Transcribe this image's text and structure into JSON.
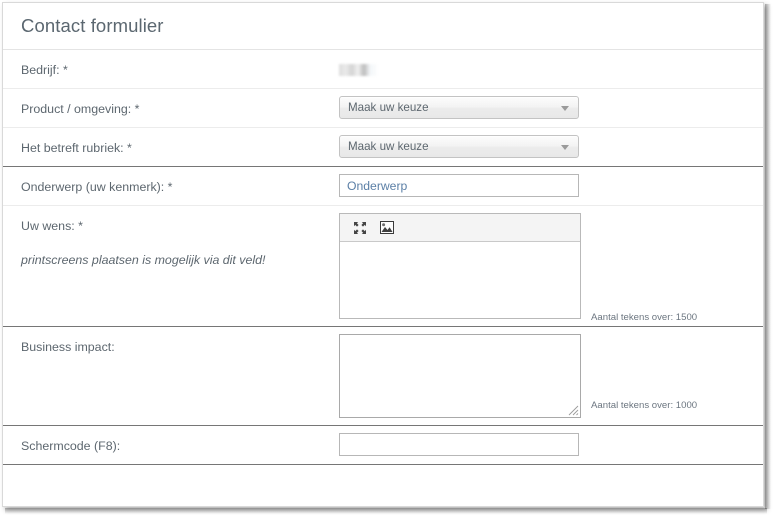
{
  "form": {
    "title": "Contact formulier",
    "rows": [
      {
        "label": "Bedrijf: *",
        "type": "redacted"
      },
      {
        "label": "Product / omgeving: *",
        "type": "select",
        "value": "Maak uw keuze"
      },
      {
        "label": "Het betreft rubriek: *",
        "type": "select",
        "value": "Maak uw keuze"
      },
      {
        "label": "Onderwerp (uw kenmerk): *",
        "type": "text",
        "value": "Onderwerp"
      },
      {
        "label": "Uw wens: *",
        "hint": "printscreens plaatsen is mogelijk via dit veld!",
        "type": "editor",
        "value": "",
        "counter": "Aantal tekens over: 1500",
        "toolbar": [
          {
            "name": "fullscreen-icon",
            "title": "Volledig scherm"
          },
          {
            "name": "image-icon",
            "title": "Afbeelding invoegen"
          }
        ]
      },
      {
        "label": "Business impact:",
        "type": "textarea",
        "value": "",
        "counter": "Aantal tekens over: 1000"
      },
      {
        "label": "Schermcode (F8):",
        "type": "text",
        "value": ""
      }
    ]
  },
  "colors": {
    "label_text": "#5d676f",
    "title_text": "#5b6770",
    "placeholder_blue": "#5b7fa6",
    "separator_light": "#ececec",
    "separator_dark": "#767676",
    "toolbar_bg": "#f4f4f4"
  }
}
